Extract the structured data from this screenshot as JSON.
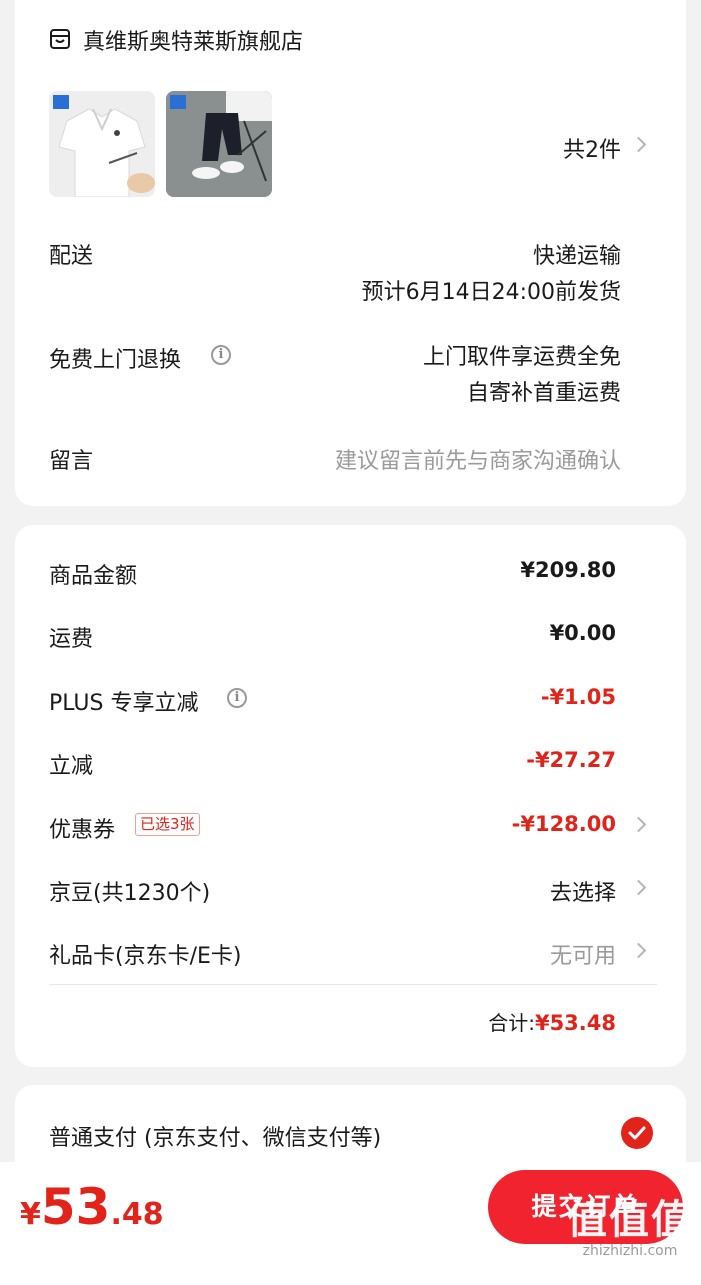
{
  "shop": {
    "icon": "shop-icon",
    "name": "真维斯奥特莱斯旗舰店",
    "items": [
      {
        "name": "白色POLO衫",
        "icon": "product-thumb-polo"
      },
      {
        "name": "黑色休闲裤",
        "icon": "product-thumb-pants"
      }
    ],
    "count_prefix": "共",
    "count_value": "2",
    "count_suffix": "件"
  },
  "delivery": {
    "label": "配送",
    "method": "快递运输",
    "eta": "预计6月14日24:00前发货"
  },
  "return": {
    "label": "免费上门退换",
    "line1": "上门取件享运费全免",
    "line2": "自寄补首重运费"
  },
  "message": {
    "label": "留言",
    "placeholder": "建议留言前先与商家沟通确认"
  },
  "price": {
    "goods_label": "商品金额",
    "goods_value": "¥209.80",
    "shipping_label": "运费",
    "shipping_value": "¥0.00",
    "plus_label": "PLUS 专享立减",
    "plus_value": "-¥1.05",
    "discount_label": "立减",
    "discount_value": "-¥27.27",
    "coupon_label": "优惠券",
    "coupon_badge": "已选3张",
    "coupon_value": "-¥128.00",
    "beans_label": "京豆(共1230个)",
    "beans_value": "去选择",
    "giftcard_label": "礼品卡(京东卡/E卡)",
    "giftcard_value": "无可用",
    "total_label": "合计:",
    "total_value": "¥53.48"
  },
  "payment": {
    "label": "普通支付 (京东支付、微信支付等)",
    "selected": true
  },
  "bottom": {
    "currency": "¥",
    "amount_int": "53",
    "amount_dec": ".48",
    "submit_label": "提交订单",
    "watermark_text": "值值值",
    "watermark_url": "zhizhizhi.com"
  },
  "colors": {
    "accent": "#e2231a",
    "background": "#f2f2f2"
  }
}
